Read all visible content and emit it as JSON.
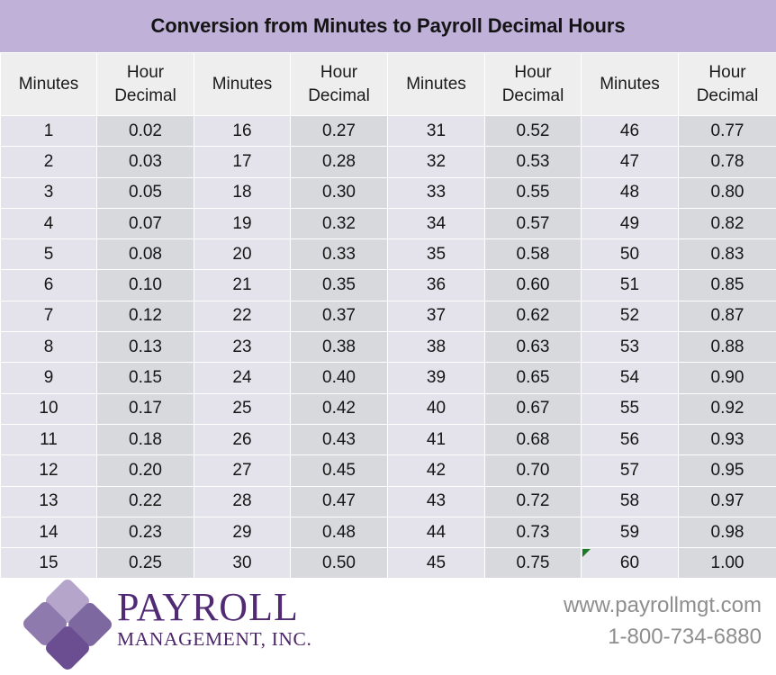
{
  "title": "Conversion from Minutes to Payroll Decimal Hours",
  "colors": {
    "title_bar": "#bfb1d8",
    "header_cell": "#eeeeee",
    "minutes_cell": "#e4e2ea",
    "decimal_cell": "#d7d9dd",
    "logo_purple_dark": "#512a74",
    "logo_purple_light": "#b5a5cb",
    "error_marker_green": "#1a7a26",
    "contact_gray": "#8e8e8e"
  },
  "table": {
    "headers": [
      "Minutes",
      "Hour Decimal",
      "Minutes",
      "Hour Decimal",
      "Minutes",
      "Hour Decimal",
      "Minutes",
      "Hour Decimal"
    ],
    "header_lines": [
      [
        "Minutes"
      ],
      [
        "Hour",
        "Decimal"
      ],
      [
        "Minutes"
      ],
      [
        "Hour",
        "Decimal"
      ],
      [
        "Minutes"
      ],
      [
        "Hour",
        "Decimal"
      ],
      [
        "Minutes"
      ],
      [
        "Hour",
        "Decimal"
      ]
    ],
    "rows": [
      [
        "1",
        "0.02",
        "16",
        "0.27",
        "31",
        "0.52",
        "46",
        "0.77"
      ],
      [
        "2",
        "0.03",
        "17",
        "0.28",
        "32",
        "0.53",
        "47",
        "0.78"
      ],
      [
        "3",
        "0.05",
        "18",
        "0.30",
        "33",
        "0.55",
        "48",
        "0.80"
      ],
      [
        "4",
        "0.07",
        "19",
        "0.32",
        "34",
        "0.57",
        "49",
        "0.82"
      ],
      [
        "5",
        "0.08",
        "20",
        "0.33",
        "35",
        "0.58",
        "50",
        "0.83"
      ],
      [
        "6",
        "0.10",
        "21",
        "0.35",
        "36",
        "0.60",
        "51",
        "0.85"
      ],
      [
        "7",
        "0.12",
        "22",
        "0.37",
        "37",
        "0.62",
        "52",
        "0.87"
      ],
      [
        "8",
        "0.13",
        "23",
        "0.38",
        "38",
        "0.63",
        "53",
        "0.88"
      ],
      [
        "9",
        "0.15",
        "24",
        "0.40",
        "39",
        "0.65",
        "54",
        "0.90"
      ],
      [
        "10",
        "0.17",
        "25",
        "0.42",
        "40",
        "0.67",
        "55",
        "0.92"
      ],
      [
        "11",
        "0.18",
        "26",
        "0.43",
        "41",
        "0.68",
        "56",
        "0.93"
      ],
      [
        "12",
        "0.20",
        "27",
        "0.45",
        "42",
        "0.70",
        "57",
        "0.95"
      ],
      [
        "13",
        "0.22",
        "28",
        "0.47",
        "43",
        "0.72",
        "58",
        "0.97"
      ],
      [
        "14",
        "0.23",
        "29",
        "0.48",
        "44",
        "0.73",
        "59",
        "0.98"
      ],
      [
        "15",
        "0.25",
        "30",
        "0.50",
        "45",
        "0.75",
        "60",
        "1.00"
      ]
    ],
    "marker_cell": {
      "row": 14,
      "col": 6,
      "type": "green-error-triangle"
    }
  },
  "footer": {
    "logo": {
      "name_main": "PAYROLL",
      "name_sub": "MANAGEMENT, INC.",
      "diamond_count": 4
    },
    "website": "www.payrollmgt.com",
    "phone": "1-800-734-6880"
  }
}
